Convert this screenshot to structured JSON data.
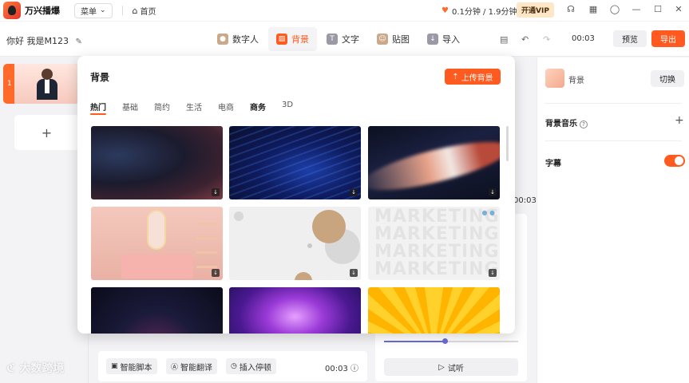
{
  "app": {
    "name": "万兴播爆"
  },
  "topbar": {
    "menu_label": "菜单",
    "home_label": "首页",
    "quota_text": "0.1分钟 / 1.9分钟",
    "vip_label": "开通VIP",
    "icons": [
      "headset-icon",
      "grid-icon",
      "user-icon",
      "minimize-icon",
      "maximize-icon",
      "close-icon"
    ]
  },
  "project": {
    "title": "你好 我是M123"
  },
  "tabs": [
    {
      "label": "数字人",
      "icon": "digital-human-icon",
      "color": "#c9a98a"
    },
    {
      "label": "背景",
      "icon": "background-icon",
      "color": "#ff5a1f",
      "active": true
    },
    {
      "label": "文字",
      "icon": "text-icon",
      "color": "#9a9aa6"
    },
    {
      "label": "贴图",
      "icon": "sticker-icon",
      "color": "#c9a98a"
    },
    {
      "label": "导入",
      "icon": "import-icon",
      "color": "#9a9aa6"
    }
  ],
  "toolbar": {
    "time": "00:03",
    "preview_label": "预览",
    "export_label": "导出"
  },
  "scenes": [
    {
      "number": "1"
    }
  ],
  "popup": {
    "title": "背景",
    "upload_label": "上传背景",
    "categories": [
      "热门",
      "基础",
      "简约",
      "生活",
      "电商",
      "商务",
      "3D"
    ],
    "active_category": "热门",
    "tile_text": "MARKETING"
  },
  "script_area": {
    "smart_script": "智能脚本",
    "smart_translate": "智能翻译",
    "insert_pause": "插入停顿",
    "time": "00:03",
    "side_time": "00:03"
  },
  "voice": {
    "listen_label": "试听",
    "speed_fraction": 0.45
  },
  "settings": {
    "background_label": "背景",
    "switch_label": "切换",
    "music_label": "背景音乐",
    "subtitle_label": "字幕",
    "subtitle_on": true
  },
  "watermark": "大数跨境",
  "colors": {
    "accent": "#ff5a1f",
    "vip_bg": "#fde7c6",
    "slider": "#6b6bd6"
  }
}
